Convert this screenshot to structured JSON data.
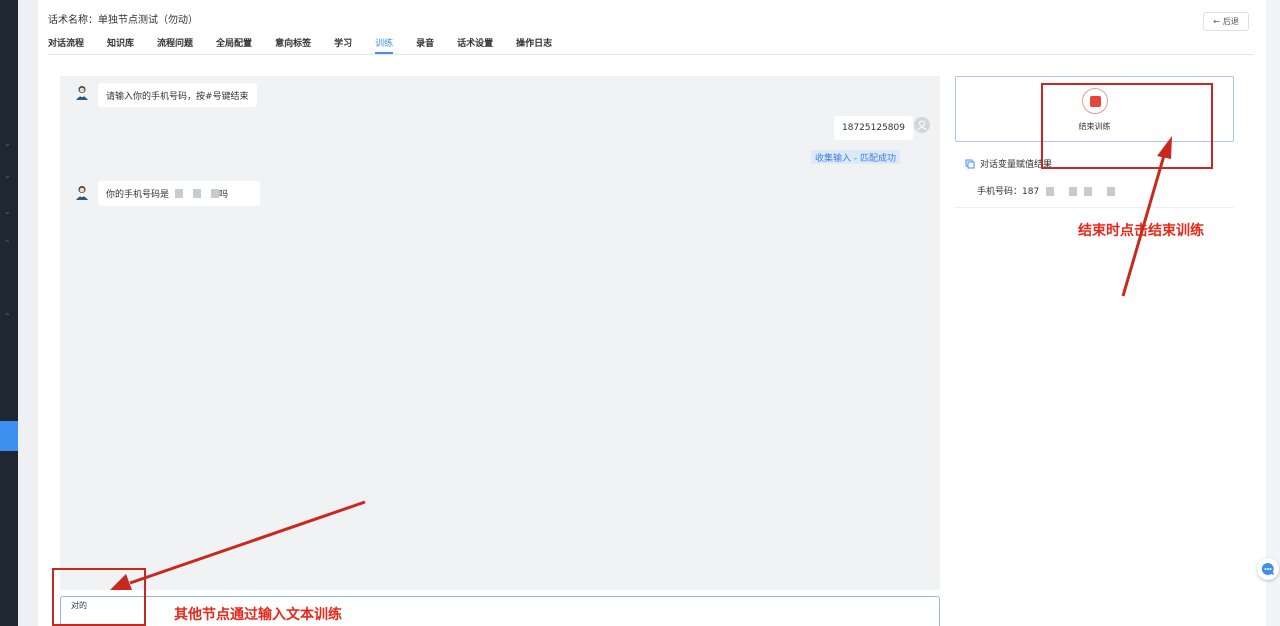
{
  "header": {
    "title": "话术名称：单独节点测试（勿动）",
    "back_label": "后退"
  },
  "tabs": [
    {
      "label": "对话流程"
    },
    {
      "label": "知识库"
    },
    {
      "label": "流程问题"
    },
    {
      "label": "全局配置"
    },
    {
      "label": "意向标签"
    },
    {
      "label": "学习"
    },
    {
      "label": "训练"
    },
    {
      "label": "录音"
    },
    {
      "label": "话术设置"
    },
    {
      "label": "操作日志"
    }
  ],
  "active_tab": "训练",
  "chat": {
    "messages": [
      {
        "from": "bot",
        "text": "请输入你的手机号码，按#号键结束"
      },
      {
        "from": "user",
        "text": "18725125809",
        "match_tag": "收集输入 - 匹配成功"
      },
      {
        "from": "bot",
        "text_prefix": "你的手机号码是",
        "text_suffix": "吗"
      }
    ],
    "input_value": "对的"
  },
  "control": {
    "stop_label": "结束训练"
  },
  "result": {
    "title": "对话变量赋值结果",
    "row_label": "手机号码：",
    "row_value_prefix": "187"
  },
  "annotations": {
    "end_hint": "结束时点击结束训练",
    "input_hint": "其他节点通过输入文本训练"
  },
  "colors": {
    "accent": "#3d8ff0",
    "annotation_red": "#e8271a",
    "stop_red": "#e84439"
  }
}
